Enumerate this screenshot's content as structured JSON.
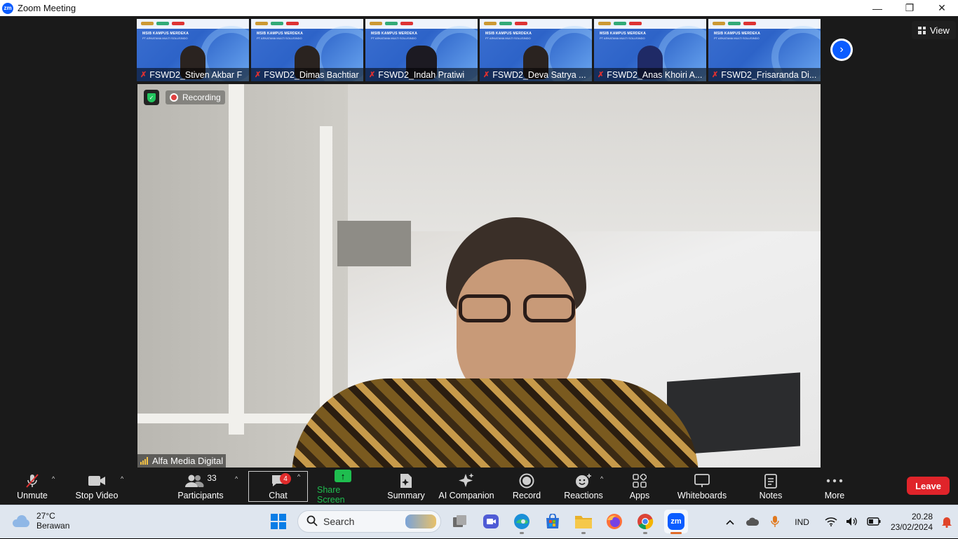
{
  "window": {
    "title": "Zoom Meeting",
    "logo_text": "zm",
    "minimize": "—",
    "restore": "❐",
    "close": "✕"
  },
  "thumb_banner": {
    "title": "MSIB KAMPUS MERDEKA",
    "subtitle": "PT ARKATAMA MULTI SOLUSINDO"
  },
  "participants_strip": [
    {
      "name": "FSWD2_Stiven Akbar F"
    },
    {
      "name": "FSWD2_Dimas Bachtiar"
    },
    {
      "name": "FSWD2_Indah Pratiwi"
    },
    {
      "name": "FSWD2_Deva Satrya ..."
    },
    {
      "name": "FSWD2_Anas Khoiri A..."
    },
    {
      "name": "FSWD2_Frisaranda Di..."
    }
  ],
  "view_button": {
    "label": "View"
  },
  "recording": {
    "label": "Recording"
  },
  "active_speaker": {
    "name": "Alfa Media Digital"
  },
  "toolbar": {
    "unmute": "Unmute",
    "stop_video": "Stop Video",
    "participants": "Participants",
    "participants_count": "33",
    "chat": "Chat",
    "chat_badge": "4",
    "share_screen": "Share Screen",
    "summary": "Summary",
    "ai_companion": "AI Companion",
    "record": "Record",
    "reactions": "Reactions",
    "apps": "Apps",
    "whiteboards": "Whiteboards",
    "notes": "Notes",
    "more": "More",
    "leave": "Leave"
  },
  "taskbar": {
    "weather_temp": "27°C",
    "weather_desc": "Berawan",
    "search_label": "Search",
    "language": "IND",
    "time": "20.28",
    "date": "23/02/2024",
    "zoom_icon_text": "zm"
  },
  "colors": {
    "accent": "#0b5cff",
    "share_green": "#1fbe4f",
    "leave_red": "#e0242a",
    "badge_red": "#e02b2b"
  }
}
